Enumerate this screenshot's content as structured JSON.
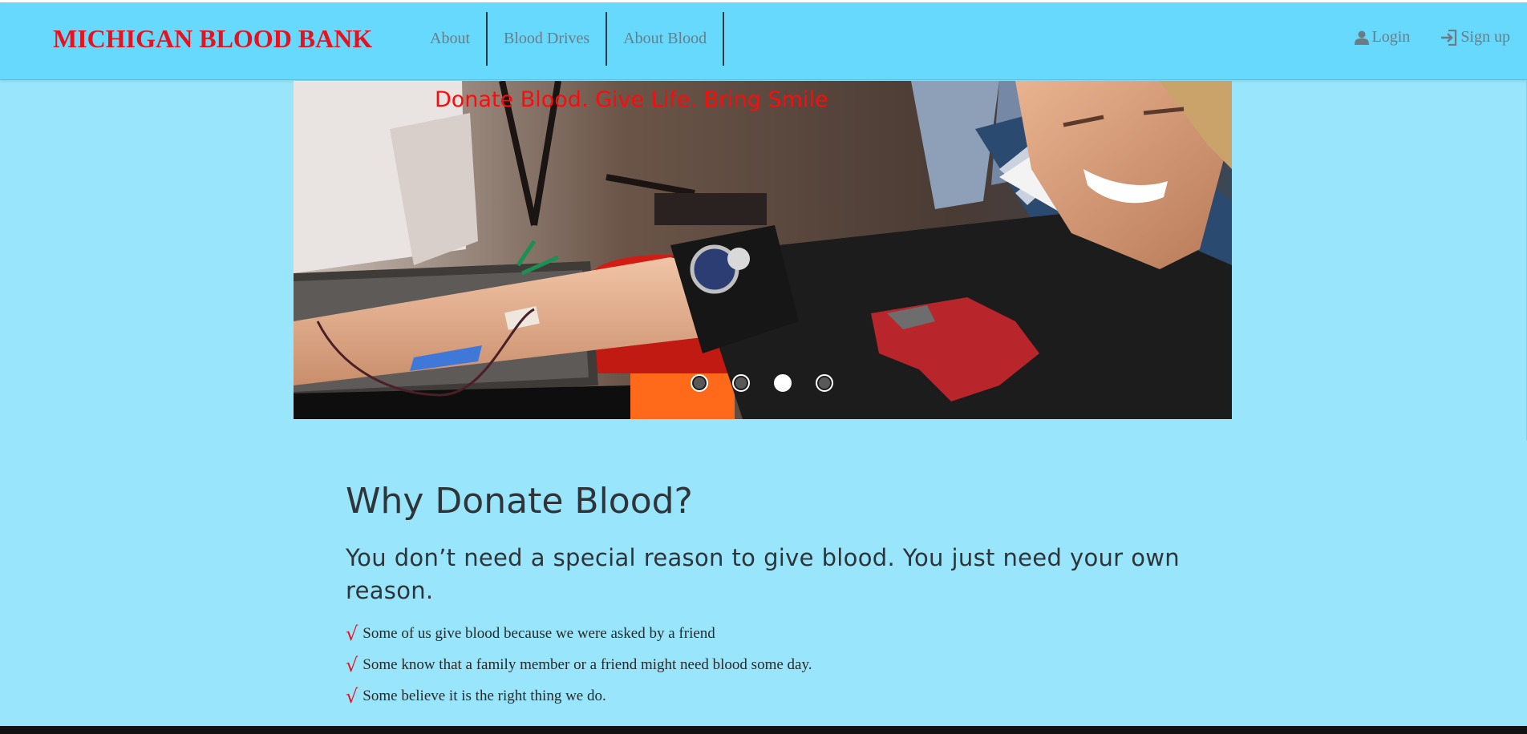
{
  "navbar": {
    "brand": "MICHIGAN BLOOD BANK",
    "links": [
      "About",
      "Blood Drives",
      "About Blood"
    ],
    "login": "Login",
    "signup": "Sign up",
    "colors": {
      "background": "#66d9fc",
      "brand": "#e8121f",
      "link": "#6a7d86"
    }
  },
  "carousel": {
    "caption": "Donate Blood. Give Life. Bring Smile",
    "slide_count": 4,
    "active_index": 2
  },
  "content": {
    "heading": "Why Donate Blood?",
    "lead": "You don’t need a special reason to give blood. You just need your own reason.",
    "reasons": [
      "Some of us give blood because we were asked by a friend",
      "Some know that a family member or a friend might need blood some day.",
      "Some believe it is the right thing we do."
    ],
    "check_icon": "check-icon",
    "check_glyph": "√"
  },
  "theme": {
    "page_background": "#99e5fb",
    "accent": "#e8121f"
  }
}
